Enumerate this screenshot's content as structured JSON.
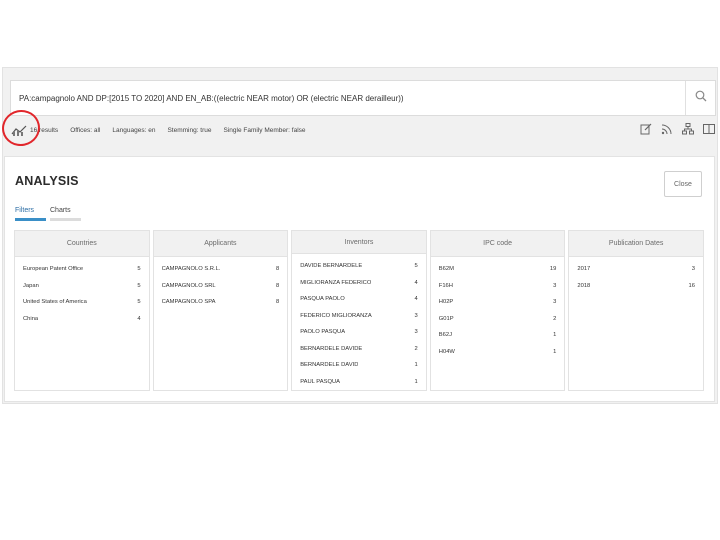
{
  "search": {
    "query": "PA:campagnolo AND DP:[2015 TO 2020] AND EN_AB:((electric NEAR motor) OR (electric NEAR derailleur))"
  },
  "filters": {
    "items": [
      "16 results",
      "Offices: all",
      "Languages: en",
      "Stemming: true",
      "Single Family Member: false"
    ]
  },
  "panel": {
    "title": "ANALYSIS",
    "close_label": "Close",
    "tabs": [
      "Filters",
      "Charts"
    ]
  },
  "columns": [
    {
      "header": "Countries",
      "rows": [
        {
          "name": "European Patent Office",
          "count": "5"
        },
        {
          "name": "Japan",
          "count": "5"
        },
        {
          "name": "United States of America",
          "count": "5"
        },
        {
          "name": "China",
          "count": "4"
        }
      ]
    },
    {
      "header": "Applicants",
      "rows": [
        {
          "name": "CAMPAGNOLO S.R.L.",
          "count": "8"
        },
        {
          "name": "CAMPAGNOLO SRL",
          "count": "8"
        },
        {
          "name": "CAMPAGNOLO SPA",
          "count": "8"
        }
      ]
    },
    {
      "header": "Inventors",
      "rows": [
        {
          "name": "DAVIDE BERNARDELE",
          "count": "5"
        },
        {
          "name": "MIGLIORANZA FEDERICO",
          "count": "4"
        },
        {
          "name": "PASQUA PAOLO",
          "count": "4"
        },
        {
          "name": "FEDERICO MIGLIORANZA",
          "count": "3"
        },
        {
          "name": "PAOLO PASQUA",
          "count": "3"
        },
        {
          "name": "BERNARDELE DAVIDE",
          "count": "2"
        },
        {
          "name": "BERNARDELE DAVID",
          "count": "1"
        },
        {
          "name": "PAUL PASQUA",
          "count": "1"
        }
      ]
    },
    {
      "header": "IPC code",
      "rows": [
        {
          "name": "B62M",
          "count": "19"
        },
        {
          "name": "F16H",
          "count": "3"
        },
        {
          "name": "H02P",
          "count": "3"
        },
        {
          "name": "G01P",
          "count": "2"
        },
        {
          "name": "B62J",
          "count": "1"
        },
        {
          "name": "H04W",
          "count": "1"
        }
      ]
    },
    {
      "header": "Publication Dates",
      "rows": [
        {
          "name": "2017",
          "count": "3"
        },
        {
          "name": "2018",
          "count": "16"
        }
      ]
    }
  ],
  "icons": {
    "search": "search-icon",
    "analysis": "chart-icon",
    "toolbar": [
      "edit-icon",
      "rss-icon",
      "hierarchy-icon",
      "split-view-icon"
    ]
  },
  "colors": {
    "tab_active": "#3a8fc7",
    "annotation": "#e1262b"
  }
}
